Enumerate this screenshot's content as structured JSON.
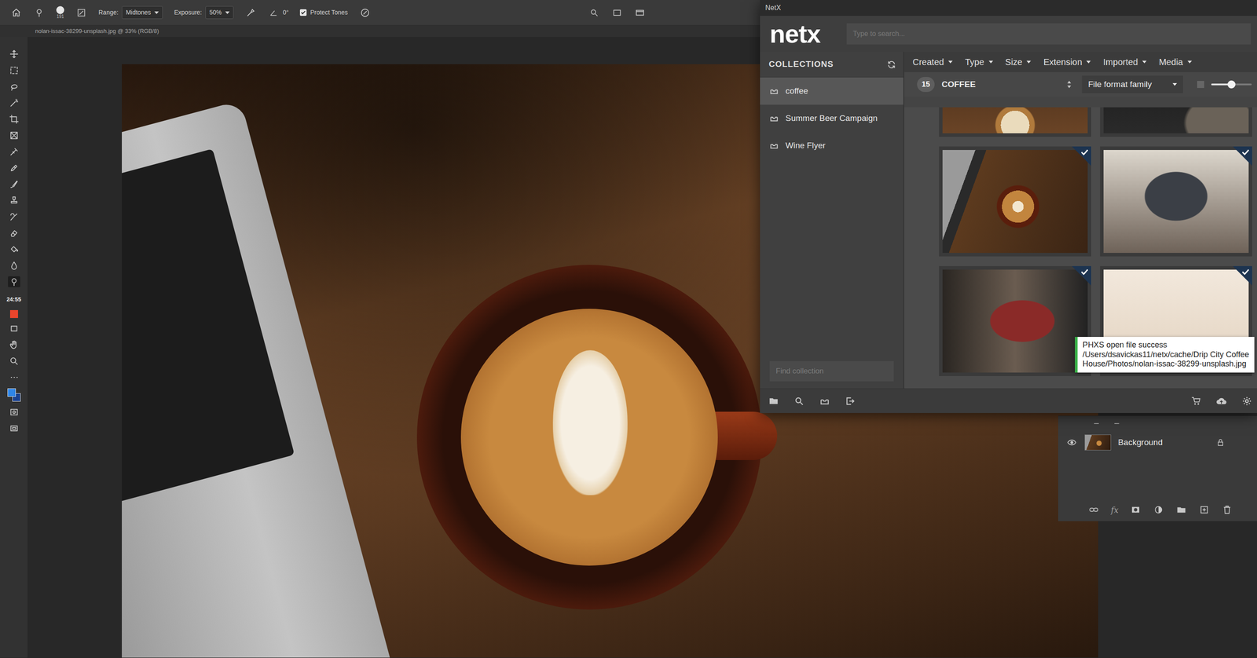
{
  "options_bar": {
    "brush_size": "191",
    "range": {
      "label": "Range:",
      "value": "Midtones"
    },
    "exposure": {
      "label": "Exposure:",
      "value": "50%"
    },
    "angle": "0°",
    "protect_tones": {
      "label": "Protect Tones",
      "checked": true
    }
  },
  "document": {
    "title": "nolan-issac-38299-unsplash.jpg @ 33% (RGB/8)"
  },
  "tools": {
    "timer": "24:55"
  },
  "netx": {
    "window_title": "NetX",
    "logo": "netx",
    "search": {
      "placeholder": "Type to search..."
    },
    "collections": {
      "header": "COLLECTIONS",
      "items": [
        {
          "name": "coffee",
          "selected": true
        },
        {
          "name": "Summer Beer Campaign",
          "selected": false
        },
        {
          "name": "Wine Flyer",
          "selected": false
        }
      ],
      "find_placeholder": "Find collection"
    },
    "filters": [
      "Created",
      "Type",
      "Size",
      "Extension",
      "Imported",
      "Media"
    ],
    "results": {
      "count": "15",
      "title": "COFFEE",
      "sort_by": "File format family",
      "thumb_size": 0.5
    },
    "assets": [
      {
        "selected": false
      },
      {
        "selected": false
      },
      {
        "selected": true
      },
      {
        "selected": true
      },
      {
        "selected": true
      },
      {
        "selected": true
      }
    ],
    "toast": {
      "lines": [
        "PHXS open file success",
        "/Users/dsavickas11/netx/cache/Drip City Coffee",
        "House/Photos/nolan-issac-38299-unsplash.jpg"
      ]
    }
  },
  "layers": {
    "items": [
      {
        "name": "Background",
        "visible": true,
        "locked": true
      }
    ],
    "fx": "fx"
  }
}
